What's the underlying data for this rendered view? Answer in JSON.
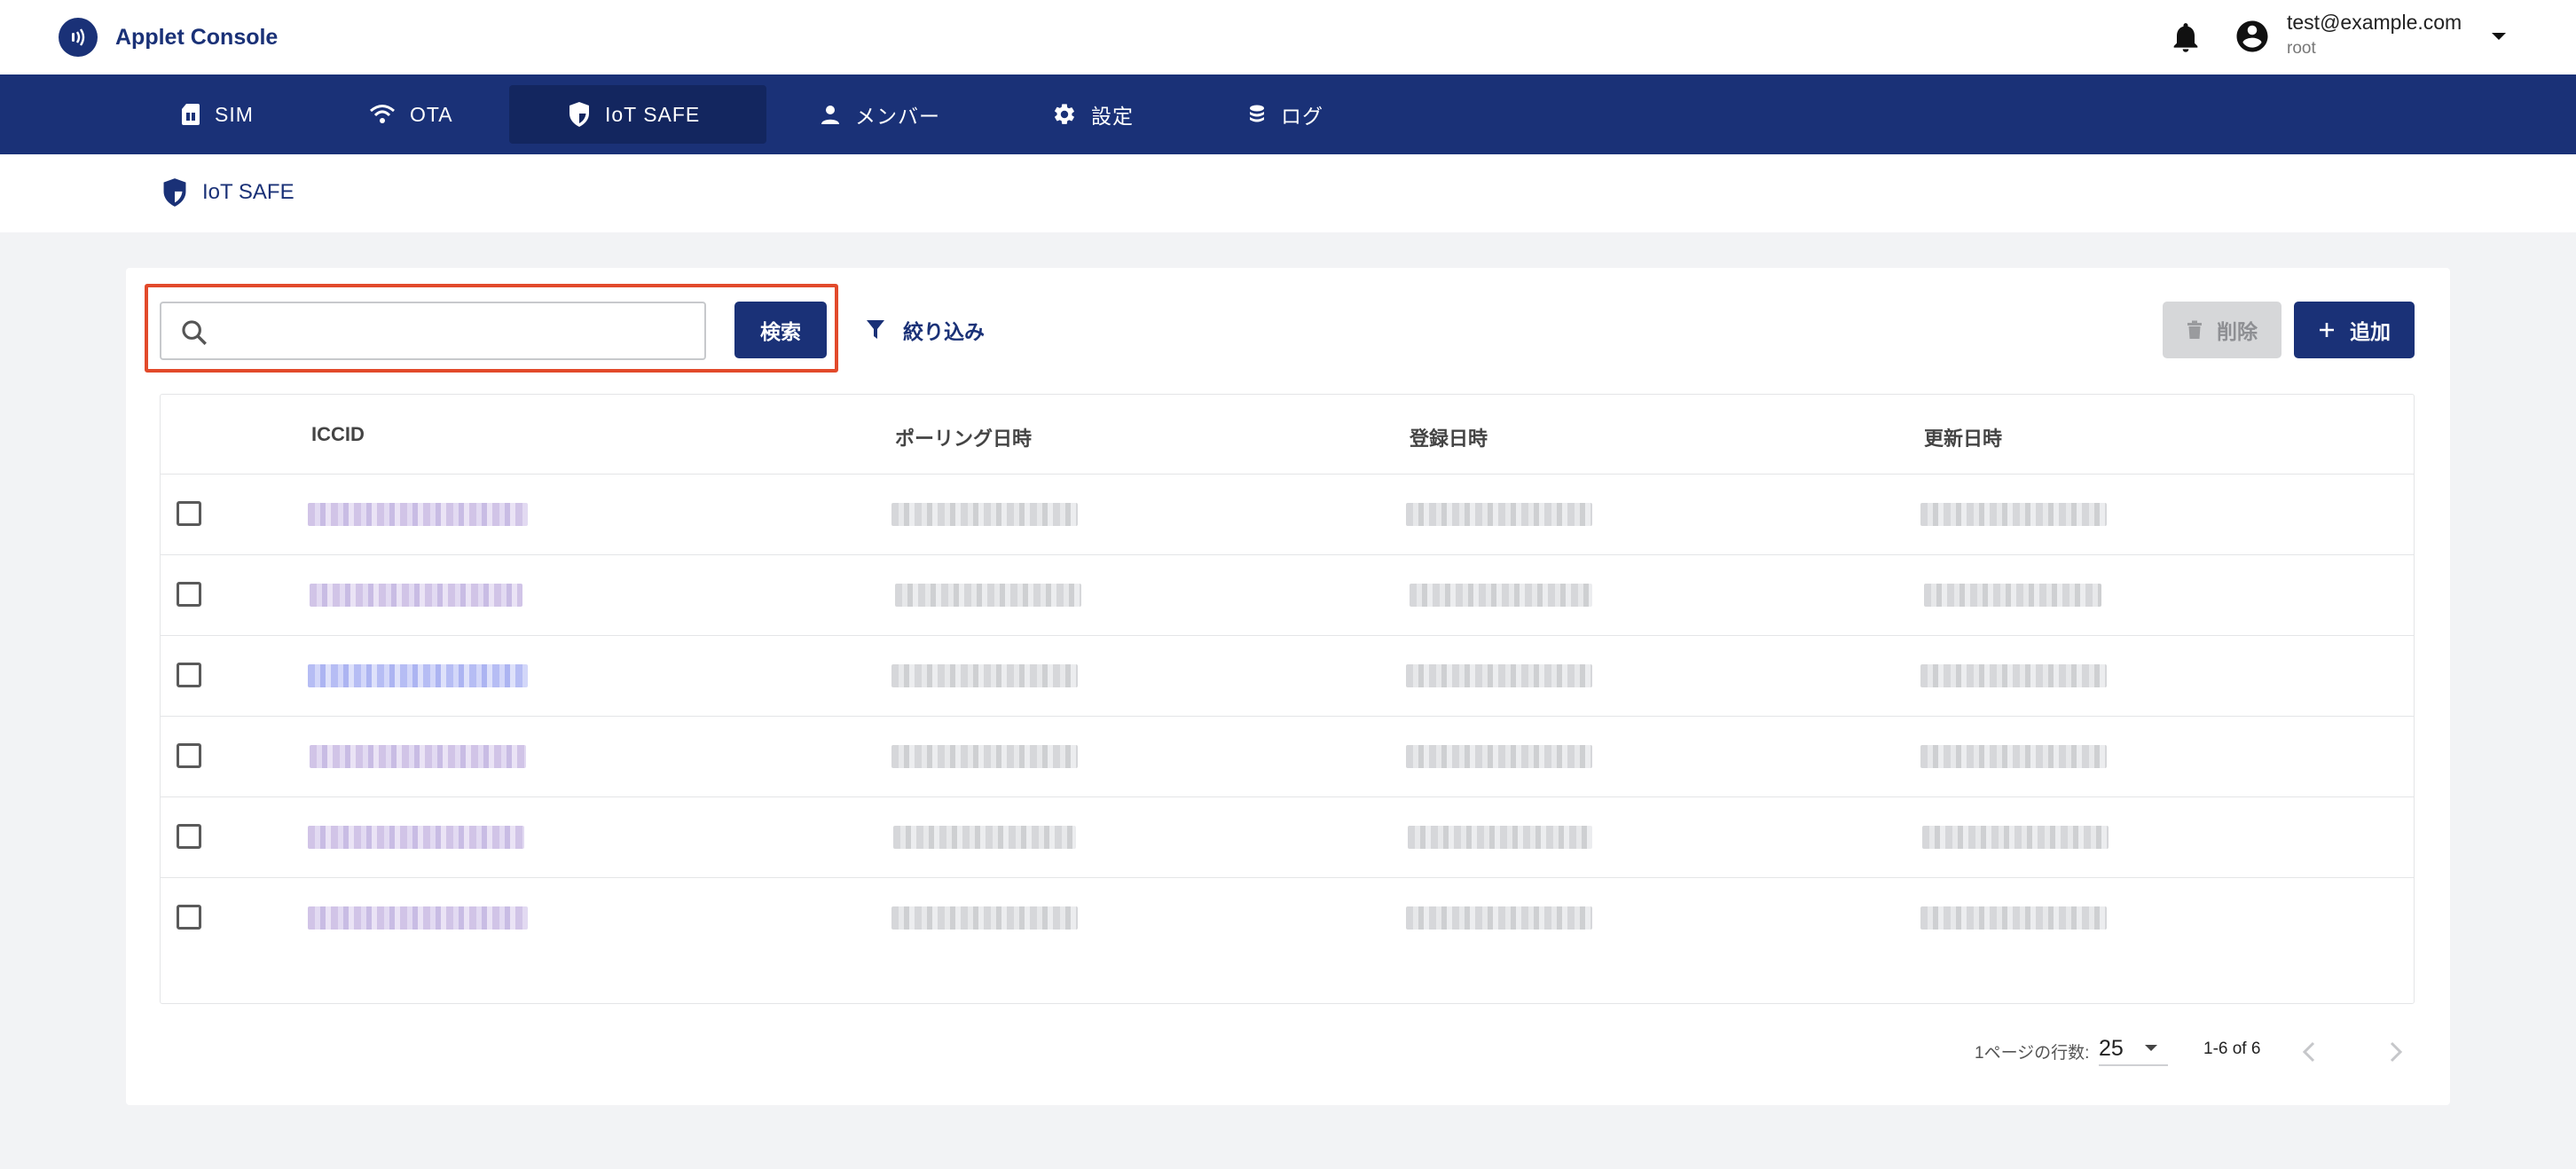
{
  "app": {
    "title": "Applet Console",
    "brand_color": "#1a3177"
  },
  "account": {
    "email": "test@example.com",
    "role": "root"
  },
  "nav": {
    "items": [
      {
        "label": "SIM",
        "icon": "sim-card-icon",
        "active": false
      },
      {
        "label": "OTA",
        "icon": "wifi-icon",
        "active": false
      },
      {
        "label": "IoT SAFE",
        "icon": "shield-icon",
        "active": true
      },
      {
        "label": "メンバー",
        "icon": "person-icon",
        "active": false
      },
      {
        "label": "設定",
        "icon": "gear-icon",
        "active": false
      },
      {
        "label": "ログ",
        "icon": "database-icon",
        "active": false
      }
    ]
  },
  "breadcrumb": {
    "label": "IoT SAFE"
  },
  "toolbar": {
    "search_value": "",
    "search_label": "検索",
    "filter_label": "絞り込み",
    "delete_label": "削除",
    "add_label": "追加",
    "highlight_color": "#e24a2b"
  },
  "table": {
    "columns": [
      "ICCID",
      "ポーリング日時",
      "登録日時",
      "更新日時"
    ],
    "row_count": 6
  },
  "pagination": {
    "rows_per_page_label": "1ページの行数:",
    "rows_per_page": "25",
    "range": "1-6 of 6"
  }
}
